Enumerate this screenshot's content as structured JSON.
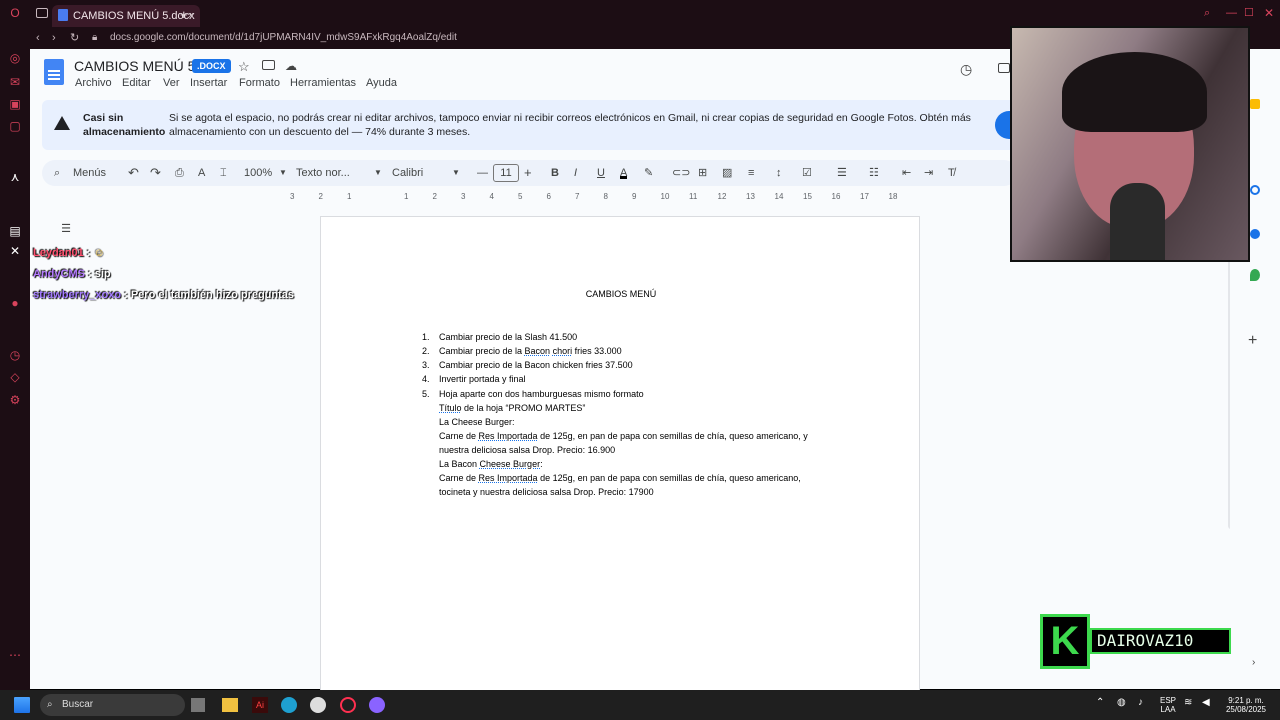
{
  "browser": {
    "tab_title": "CAMBIOS MENÚ 5.docx",
    "tab_close": "×",
    "new_tab": "+",
    "url": "docs.google.com/document/d/1d7jUPMARN4IV_mdwS9AFxkRgq4AoalZq/edit"
  },
  "docs": {
    "title": "CAMBIOS MENÚ 5",
    "badge": ".DOCX",
    "menu": [
      "Archivo",
      "Editar",
      "Ver",
      "Insertar",
      "Formato",
      "Herramientas",
      "Ayuda"
    ],
    "banner": {
      "title": "Casi sin almacenamiento",
      "text": "Si se agota el espacio, no podrás crear ni editar archivos, tampoco enviar ni recibir correos electrónicos en Gmail, ni crear copias de seguridad en Google Fotos. Obtén más almacenamiento con un descuento del — 74% durante 3 meses."
    },
    "toolbar": {
      "search_label": "Menús",
      "zoom": "100%",
      "style": "Texto nor...",
      "font": "Calibri",
      "font_size": "11"
    },
    "ruler_ticks": [
      "3",
      "2",
      "1",
      "",
      "1",
      "2",
      "3",
      "4",
      "5",
      "6",
      "7",
      "8",
      "9",
      "10",
      "11",
      "12",
      "13",
      "14",
      "15",
      "16",
      "17",
      "18"
    ]
  },
  "document": {
    "heading": "CAMBIOS MENÚ",
    "list": [
      {
        "num": "1.",
        "text": "Cambiar precio de la Slash 41.500"
      },
      {
        "num": "2.",
        "text_a": "Cambiar precio de la ",
        "u1": "Bacon",
        "mid": " ",
        "u2": "chori",
        "text_b": " fries 33.000"
      },
      {
        "num": "3.",
        "text": "Cambiar precio de la Bacon chicken fries 37.500"
      },
      {
        "num": "4.",
        "text": "Invertir portada y final"
      },
      {
        "num": "5.",
        "text": "Hoja aparte con dos hamburguesas mismo formato"
      }
    ],
    "body": {
      "title_u": "Título",
      "title_rest": " de la hoja “PROMO MARTES”",
      "cheese_name": "La Cheese Burger:",
      "cheese_a": "Carne de ",
      "cheese_u": "Res Importada",
      "cheese_b": " de 125g, en pan de papa con semillas de chía, queso americano, y",
      "cheese_c": "nuestra deliciosa salsa Drop. Precio: 16.900",
      "bacon_name_a": "La Bacon ",
      "bacon_name_u": "Cheese Burger",
      "bacon_name_b": ":",
      "bacon_a": "Carne de ",
      "bacon_u": "Res Importada",
      "bacon_b": " de 125g, en pan de papa con semillas de chía, queso americano,",
      "bacon_c": "tocineta y nuestra deliciosa salsa Drop. Precio: 17900"
    }
  },
  "chat": [
    {
      "user": "Leydan01",
      "sep": " : ",
      "msg": "☺"
    },
    {
      "user": "AndyCMS",
      "sep": " : ",
      "msg": "sip"
    },
    {
      "user": "strawberry_xoxo",
      "sep": " : ",
      "msg": "Pero el también hizo preguntas"
    }
  ],
  "stream_logo": {
    "letter": "K",
    "text": "DAIROVAZ10"
  },
  "taskbar": {
    "search": "Buscar",
    "lang_top": "ESP",
    "lang_bottom": "LAA",
    "time": "9:21 p. m.",
    "date": "25/08/2025"
  },
  "colors": {
    "accent": "#1a73e8",
    "opera_red": "#d8435c",
    "chat_user1": "#ff4f6e",
    "chat_user2": "#b57bff",
    "chat_user3": "#a37bff",
    "logo_green": "#3dd94d"
  }
}
